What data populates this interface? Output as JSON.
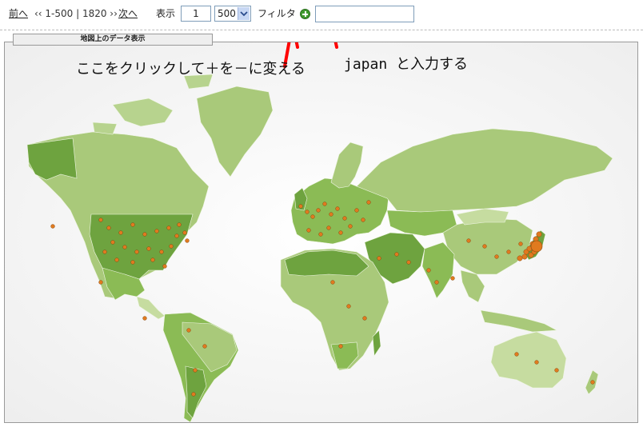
{
  "pager": {
    "prev_label": "前へ",
    "range_text": "‹‹ 1-500 | 1820 ››",
    "next_label": "次へ"
  },
  "display": {
    "label": "表示",
    "start_value": "1",
    "rows_selected": "500"
  },
  "filter": {
    "label": "フィルタ",
    "input_value": ""
  },
  "map": {
    "tab_label": "地図上のデータ表示",
    "ocean_color": "#ffffff",
    "land_light": "#c6dca0",
    "land_dark": "#6ea33f",
    "marker_color": "#e07a1f"
  },
  "annotations": {
    "note_left": "ここをクリックして＋を－に変える",
    "note_right": "japan と入力する",
    "arrow_color": "#ff0000"
  }
}
